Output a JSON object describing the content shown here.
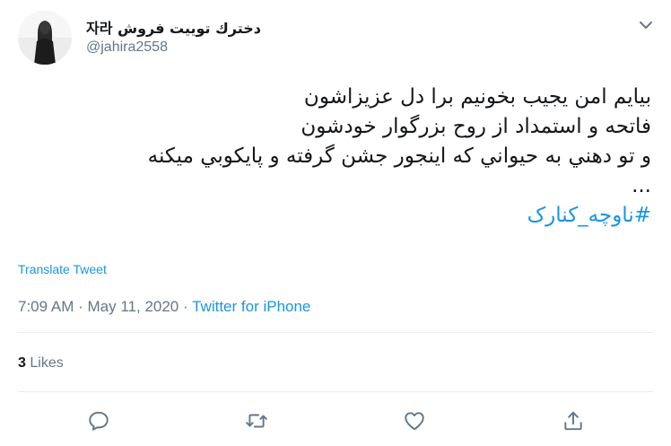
{
  "author": {
    "display_name": "자라 دخترك توييت فروش",
    "handle": "@jahira2558"
  },
  "tweet": {
    "lines": [
      "بیایم امن یجیب بخونیم برا دل عزیزاشون",
      "فاتحه و استمداد از روح بزرگوار خودشون",
      "و تو دهني به حيواني كه اينجور جشن گرفته و پايكوبي ميكنه",
      "..."
    ],
    "hashtag": "#ناوچه_کنارک"
  },
  "translate_label": "Translate Tweet",
  "meta": {
    "time": "7:09 AM",
    "separator": "·",
    "date": "May 11, 2020",
    "source": "Twitter for iPhone"
  },
  "stats": {
    "likes_count": "3",
    "likes_label": "Likes"
  },
  "icons": {
    "caret": "chevron-down-icon",
    "reply": "reply-icon",
    "retweet": "retweet-icon",
    "like": "heart-icon",
    "share": "share-icon"
  },
  "colors": {
    "link": "#1b95e0",
    "secondary_text": "#657786",
    "primary_text": "#14171a",
    "divider": "#e6ecf0"
  }
}
